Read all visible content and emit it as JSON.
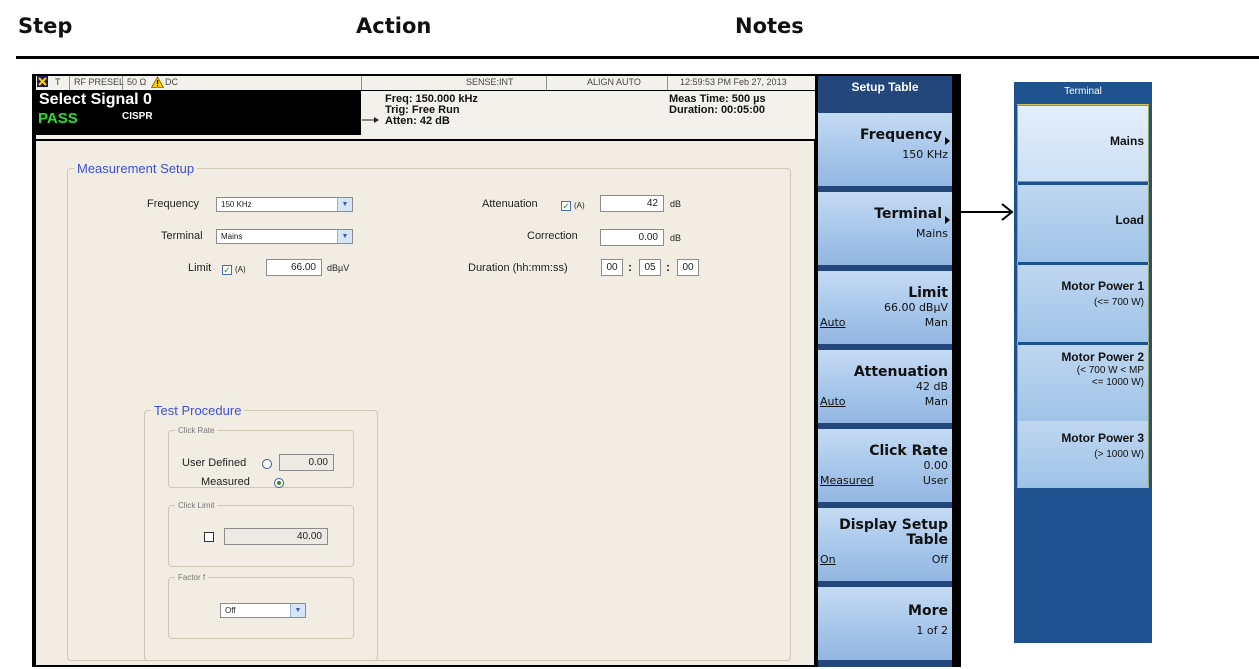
{
  "headers": {
    "step": "Step",
    "action": "Action",
    "notes": "Notes"
  },
  "statusbar": {
    "mode": "T",
    "preselector": "RF PRESEL",
    "impedance": "50 Ω",
    "coupling": "DC",
    "sense": "SENSE:INT",
    "align": "ALIGN AUTO",
    "datetime": "12:59:53 PM Feb 27, 2013"
  },
  "signal": {
    "title": "Select Signal 0",
    "status": "PASS",
    "standard": "CISPR",
    "freq": "Freq: 150.000 kHz",
    "trig": "Trig: Free Run",
    "atten": "Atten: 42 dB",
    "meas_time": "Meas Time: 500 µs",
    "duration": "Duration: 00:05:00"
  },
  "measurement_setup": {
    "title": "Measurement Setup",
    "frequency_label": "Frequency",
    "frequency_value": "150 KHz",
    "terminal_label": "Terminal",
    "terminal_value": "Mains",
    "limit_label": "Limit",
    "limit_auto": "(A)",
    "limit_value": "66.00",
    "limit_unit": "dBµV",
    "attenuation_label": "Attenuation",
    "attenuation_auto": "(A)",
    "attenuation_value": "42",
    "attenuation_unit": "dB",
    "correction_label": "Correction",
    "correction_value": "0.00",
    "correction_unit": "dB",
    "duration_label": "Duration (hh:mm:ss)",
    "duration_h": "00",
    "duration_m": "05",
    "duration_s": "00"
  },
  "test_procedure": {
    "title": "Test Procedure",
    "click_rate_title": "Click Rate",
    "user_defined_label": "User Defined",
    "user_defined_value": "0.00",
    "measured_label": "Measured",
    "click_limit_title": "Click Limit",
    "click_limit_value": "40.00",
    "factor_title": "Factor f",
    "factor_value": "Off"
  },
  "softkeys": {
    "title": "Setup Table",
    "frequency": {
      "label": "Frequency",
      "value": "150 KHz"
    },
    "terminal": {
      "label": "Terminal",
      "value": "Mains"
    },
    "limit": {
      "label": "Limit",
      "value": "66.00 dBµV",
      "left": "Auto",
      "right": "Man"
    },
    "attenuation": {
      "label": "Attenuation",
      "value": "42 dB",
      "left": "Auto",
      "right": "Man"
    },
    "click_rate": {
      "label": "Click Rate",
      "value": "0.00",
      "left": "Measured",
      "right": "User"
    },
    "display": {
      "label1": "Display Setup",
      "label2": "Table",
      "left": "On",
      "right": "Off"
    },
    "more": {
      "label": "More",
      "value": "1 of 2"
    }
  },
  "terminal_menu": {
    "title": "Terminal",
    "items": [
      {
        "label": "Mains"
      },
      {
        "label": "Load"
      },
      {
        "label": "Motor Power 1",
        "sub1": "(<= 700 W)"
      },
      {
        "label": "Motor Power 2",
        "sub1": "(< 700 W < MP",
        "sub2": "<= 1000 W)"
      },
      {
        "label": "Motor Power 3",
        "sub1": "(> 1000 W)"
      }
    ]
  },
  "colors": {
    "pass": "#28e028",
    "softkey_panel": "#24477b",
    "legend": "#3c4fd8",
    "panel_bg": "#f1ede3"
  }
}
